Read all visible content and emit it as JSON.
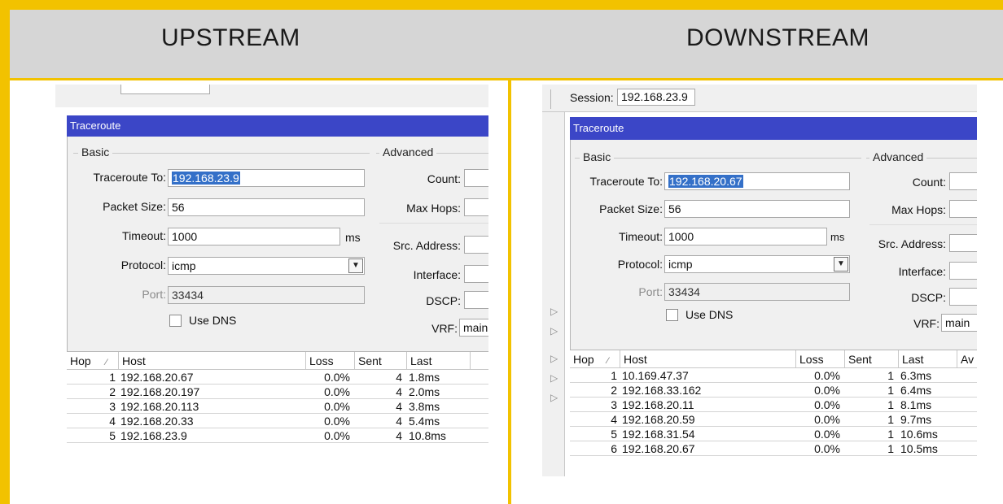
{
  "header": {
    "left_title": "UPSTREAM",
    "right_title": "DOWNSTREAM"
  },
  "colors": {
    "frame": "#f2c200",
    "header_bg": "#d6d6d6",
    "titlebar": "#3b46c7",
    "selection": "#3470c8"
  },
  "upstream": {
    "window_title": "Traceroute",
    "basic_label": "Basic",
    "advanced_label": "Advanced",
    "traceroute_to_label": "Traceroute To:",
    "traceroute_to_value": "192.168.23.9",
    "packet_size_label": "Packet Size:",
    "packet_size_value": "56",
    "timeout_label": "Timeout:",
    "timeout_value": "1000",
    "timeout_unit": "ms",
    "protocol_label": "Protocol:",
    "protocol_value": "icmp",
    "port_label": "Port:",
    "port_value": "33434",
    "use_dns_label": "Use DNS",
    "count_label": "Count:",
    "max_hops_label": "Max Hops:",
    "src_address_label": "Src. Address:",
    "interface_label": "Interface:",
    "dscp_label": "DSCP:",
    "vrf_label": "VRF:",
    "vrf_value": "main",
    "columns": {
      "hop": "Hop",
      "host": "Host",
      "loss": "Loss",
      "sent": "Sent",
      "last": "Last"
    },
    "rows": [
      {
        "hop": "1",
        "host": "192.168.20.67",
        "loss": "0.0%",
        "sent": "4",
        "last": "1.8ms"
      },
      {
        "hop": "2",
        "host": "192.168.20.197",
        "loss": "0.0%",
        "sent": "4",
        "last": "2.0ms"
      },
      {
        "hop": "3",
        "host": "192.168.20.113",
        "loss": "0.0%",
        "sent": "4",
        "last": "3.8ms"
      },
      {
        "hop": "4",
        "host": "192.168.20.33",
        "loss": "0.0%",
        "sent": "4",
        "last": "5.4ms"
      },
      {
        "hop": "5",
        "host": "192.168.23.9",
        "loss": "0.0%",
        "sent": "4",
        "last": "10.8ms"
      }
    ]
  },
  "downstream": {
    "session_label": "Session:",
    "session_value": "192.168.23.9",
    "window_title": "Traceroute",
    "basic_label": "Basic",
    "advanced_label": "Advanced",
    "traceroute_to_label": "Traceroute To:",
    "traceroute_to_value": "192.168.20.67",
    "packet_size_label": "Packet Size:",
    "packet_size_value": "56",
    "timeout_label": "Timeout:",
    "timeout_value": "1000",
    "timeout_unit": "ms",
    "protocol_label": "Protocol:",
    "protocol_value": "icmp",
    "port_label": "Port:",
    "port_value": "33434",
    "use_dns_label": "Use DNS",
    "count_label": "Count:",
    "max_hops_label": "Max Hops:",
    "src_address_label": "Src. Address:",
    "interface_label": "Interface:",
    "dscp_label": "DSCP:",
    "vrf_label": "VRF:",
    "vrf_value": "main",
    "columns": {
      "hop": "Hop",
      "host": "Host",
      "loss": "Loss",
      "sent": "Sent",
      "last": "Last",
      "avg": "Av"
    },
    "rows": [
      {
        "hop": "1",
        "host": "10.169.47.37",
        "loss": "0.0%",
        "sent": "1",
        "last": "6.3ms"
      },
      {
        "hop": "2",
        "host": "192.168.33.162",
        "loss": "0.0%",
        "sent": "1",
        "last": "6.4ms"
      },
      {
        "hop": "3",
        "host": "192.168.20.11",
        "loss": "0.0%",
        "sent": "1",
        "last": "8.1ms"
      },
      {
        "hop": "4",
        "host": "192.168.20.59",
        "loss": "0.0%",
        "sent": "1",
        "last": "9.7ms"
      },
      {
        "hop": "5",
        "host": "192.168.31.54",
        "loss": "0.0%",
        "sent": "1",
        "last": "10.6ms"
      },
      {
        "hop": "6",
        "host": "192.168.20.67",
        "loss": "0.0%",
        "sent": "1",
        "last": "10.5ms"
      }
    ]
  }
}
